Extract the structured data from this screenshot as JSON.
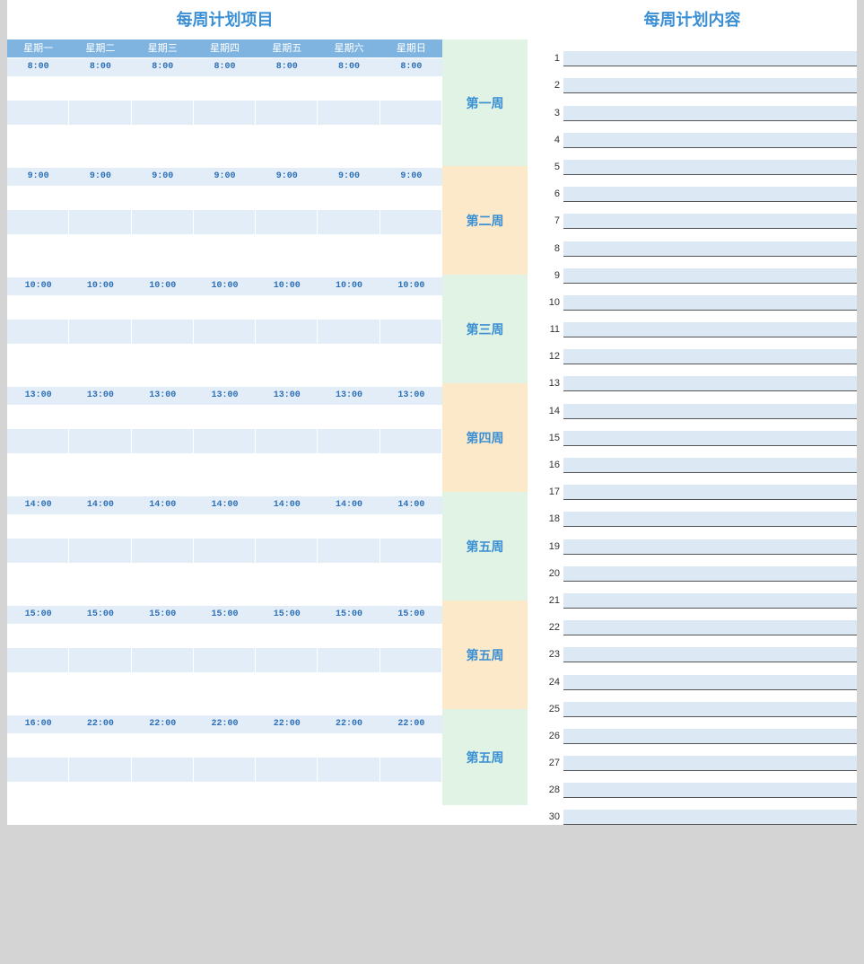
{
  "titles": {
    "left": "每周计划项目",
    "right": "每周计划内容"
  },
  "days": [
    "星期一",
    "星期二",
    "星期三",
    "星期四",
    "星期五",
    "星期六",
    "星期日"
  ],
  "time_blocks": [
    {
      "times": [
        "8:00",
        "8:00",
        "8:00",
        "8:00",
        "8:00",
        "8:00",
        "8:00"
      ]
    },
    {
      "times": [
        "9:00",
        "9:00",
        "9:00",
        "9:00",
        "9:00",
        "9:00",
        "9:00"
      ]
    },
    {
      "times": [
        "10:00",
        "10:00",
        "10:00",
        "10:00",
        "10:00",
        "10:00",
        "10:00"
      ]
    },
    {
      "times": [
        "13:00",
        "13:00",
        "13:00",
        "13:00",
        "13:00",
        "13:00",
        "13:00"
      ]
    },
    {
      "times": [
        "14:00",
        "14:00",
        "14:00",
        "14:00",
        "14:00",
        "14:00",
        "14:00"
      ]
    },
    {
      "times": [
        "15:00",
        "15:00",
        "15:00",
        "15:00",
        "15:00",
        "15:00",
        "15:00"
      ]
    },
    {
      "times": [
        "16:00",
        "22:00",
        "22:00",
        "22:00",
        "22:00",
        "22:00",
        "22:00"
      ]
    }
  ],
  "weeks": [
    {
      "label": "第一周",
      "color": "green"
    },
    {
      "label": "第二周",
      "color": "yellow"
    },
    {
      "label": "第三周",
      "color": "green"
    },
    {
      "label": "第四周",
      "color": "yellow"
    },
    {
      "label": "第五周",
      "color": "green"
    },
    {
      "label": "第五周",
      "color": "yellow"
    },
    {
      "label": "第五周",
      "color": "green"
    }
  ],
  "content_items": [
    {
      "n": "1"
    },
    {
      "n": "2"
    },
    {
      "n": "3"
    },
    {
      "n": "4"
    },
    {
      "n": "5"
    },
    {
      "n": "6"
    },
    {
      "n": "7"
    },
    {
      "n": "8"
    },
    {
      "n": "9"
    },
    {
      "n": "10"
    },
    {
      "n": "11"
    },
    {
      "n": "12"
    },
    {
      "n": "13"
    },
    {
      "n": "14"
    },
    {
      "n": "15"
    },
    {
      "n": "16"
    },
    {
      "n": "17"
    },
    {
      "n": "18"
    },
    {
      "n": "19"
    },
    {
      "n": "20"
    },
    {
      "n": "21"
    },
    {
      "n": "22"
    },
    {
      "n": "23"
    },
    {
      "n": "24"
    },
    {
      "n": "25"
    },
    {
      "n": "26"
    },
    {
      "n": "27"
    },
    {
      "n": "28"
    },
    {
      "n": "30"
    }
  ]
}
